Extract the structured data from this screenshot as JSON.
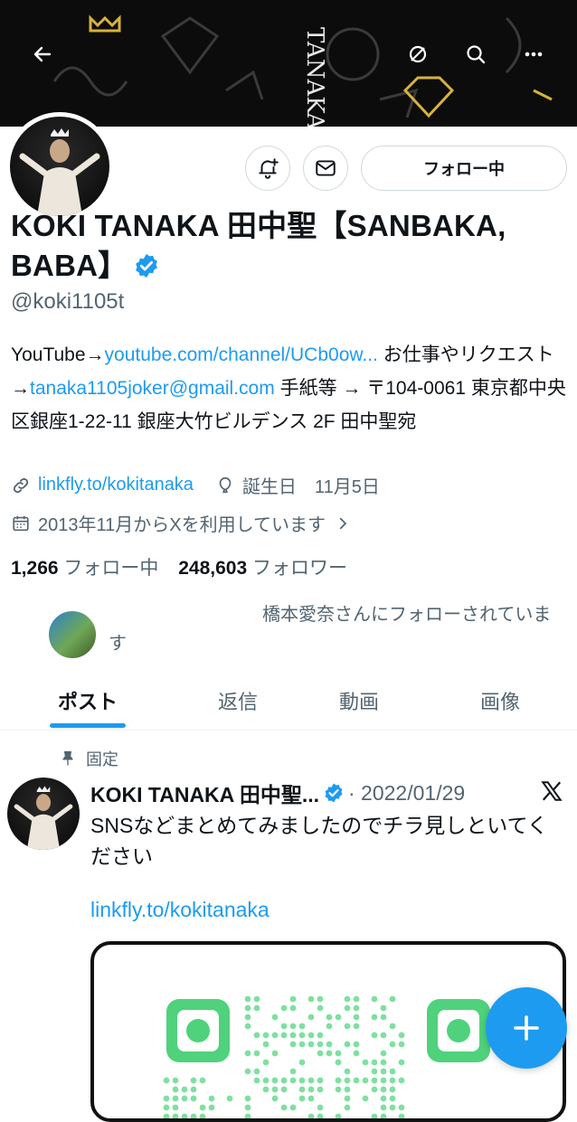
{
  "colors": {
    "accent": "#1d9bf0",
    "text": "#0f1419",
    "secondary": "#536471",
    "border": "#cfd9de",
    "gold": "#d9b23a"
  },
  "header": {
    "icons": [
      "back-arrow-icon",
      "grok-icon",
      "search-icon",
      "more-icon"
    ],
    "banner_text": "TANAKA"
  },
  "profile": {
    "follow_button": "フォロー中",
    "display_name": "KOKI TANAKA 田中聖【SANBAKA, BABA】",
    "handle": "@koki1105t",
    "bio": {
      "prefix": "YouTube→",
      "youtube_link": "youtube.com/channel/UCb0ow...",
      "middle": " お仕事やリクエスト →",
      "email_link": "tanaka1105joker@gmail.com",
      "suffix": " 手紙等 → 〒104-0061 東京都中央区銀座1-22-11 銀座大竹ビルデンス 2F 田中聖宛"
    },
    "website": "linkfly.to/kokitanaka",
    "birthday": "誕生日　11月5日",
    "joined": "2013年11月からXを利用しています",
    "following_count": "1,266",
    "following_label": "フォロー中",
    "followers_count": "248,603",
    "followers_label": "フォロワー",
    "followed_by": "橋本愛奈さんにフォローされていま",
    "followed_by_tail": "す"
  },
  "tabs": [
    "ポスト",
    "返信",
    "動画",
    "画像"
  ],
  "pinned_post": {
    "pinned_label": "固定",
    "author": "KOKI TANAKA 田中聖...",
    "date": "· 2022/01/29",
    "text": "SNSなどまとめてみましたのでチラ見しといてください",
    "link": "linkfly.to/kokitanaka"
  }
}
